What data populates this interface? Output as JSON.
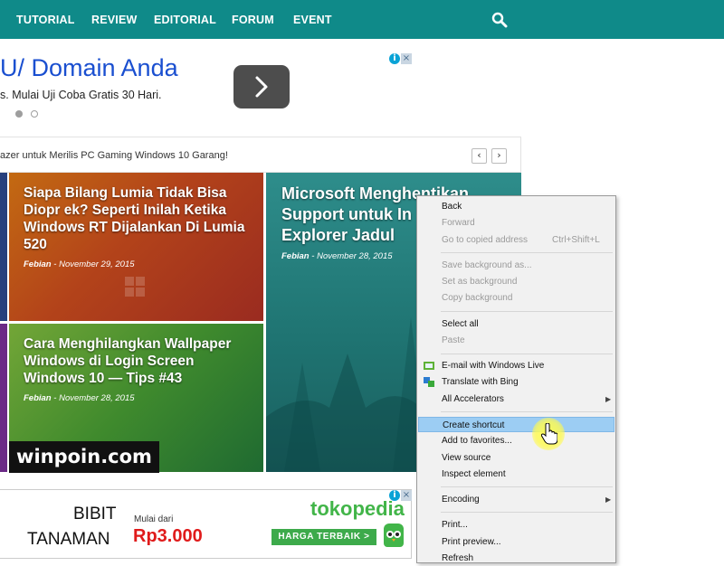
{
  "nav": {
    "items": [
      "TUTORIAL",
      "REVIEW",
      "EDITORIAL",
      "FORUM",
      "EVENT"
    ],
    "search_icon": "search-icon",
    "background": "#0f8a89"
  },
  "ad_top": {
    "title": "U/ Domain Anda",
    "subtitle": "s. Mulai Uji Coba Gratis 30 Hari.",
    "next_icon": "chevron-right-icon"
  },
  "ticker": {
    "text": "azer untuk Merilis PC Gaming Windows 10 Garang!",
    "prev": "‹",
    "next": "›"
  },
  "cards": [
    {
      "title_lines": [
        "Siapa Bilang Lumia Tidak Bisa",
        "Diopr ek? Seperti Inilah Ketika",
        "Windows RT Dijalankan Di Lumia",
        "520"
      ],
      "author": "Febian",
      "date": "November 29, 2015"
    },
    {
      "title_lines": [
        "Microsoft Menghentikan",
        "Support untuk In",
        "Explorer Jadul"
      ],
      "author": "Febian",
      "date": "November 28, 2015"
    },
    {
      "title_lines": [
        "Cara Menghilangkan Wallpaper",
        "Windows di Login Screen",
        "Windows 10 — Tips #43"
      ],
      "author": "Febian",
      "date": "November 28, 2015"
    }
  ],
  "watermark": "winpoin.com",
  "ad_bottom": {
    "line1": "BIBIT",
    "line2": "TANAMAN",
    "mulai": "Mulai dari",
    "price": "Rp3.000",
    "brand": "tokopedia",
    "cta": "HARGA TERBAIK  >"
  },
  "context_menu": {
    "back": "Back",
    "forward": "Forward",
    "go_copied": "Go to copied address",
    "go_copied_shortcut": "Ctrl+Shift+L",
    "save_bg": "Save background as...",
    "set_bg": "Set as background",
    "copy_bg": "Copy background",
    "select_all": "Select all",
    "paste": "Paste",
    "email": "E-mail with Windows Live",
    "translate": "Translate with Bing",
    "accelerators": "All Accelerators",
    "create_shortcut": "Create shortcut",
    "add_fav": "Add to favorites...",
    "view_source": "View source",
    "inspect": "Inspect element",
    "encoding": "Encoding",
    "print": "Print...",
    "print_preview": "Print preview...",
    "refresh": "Refresh"
  }
}
